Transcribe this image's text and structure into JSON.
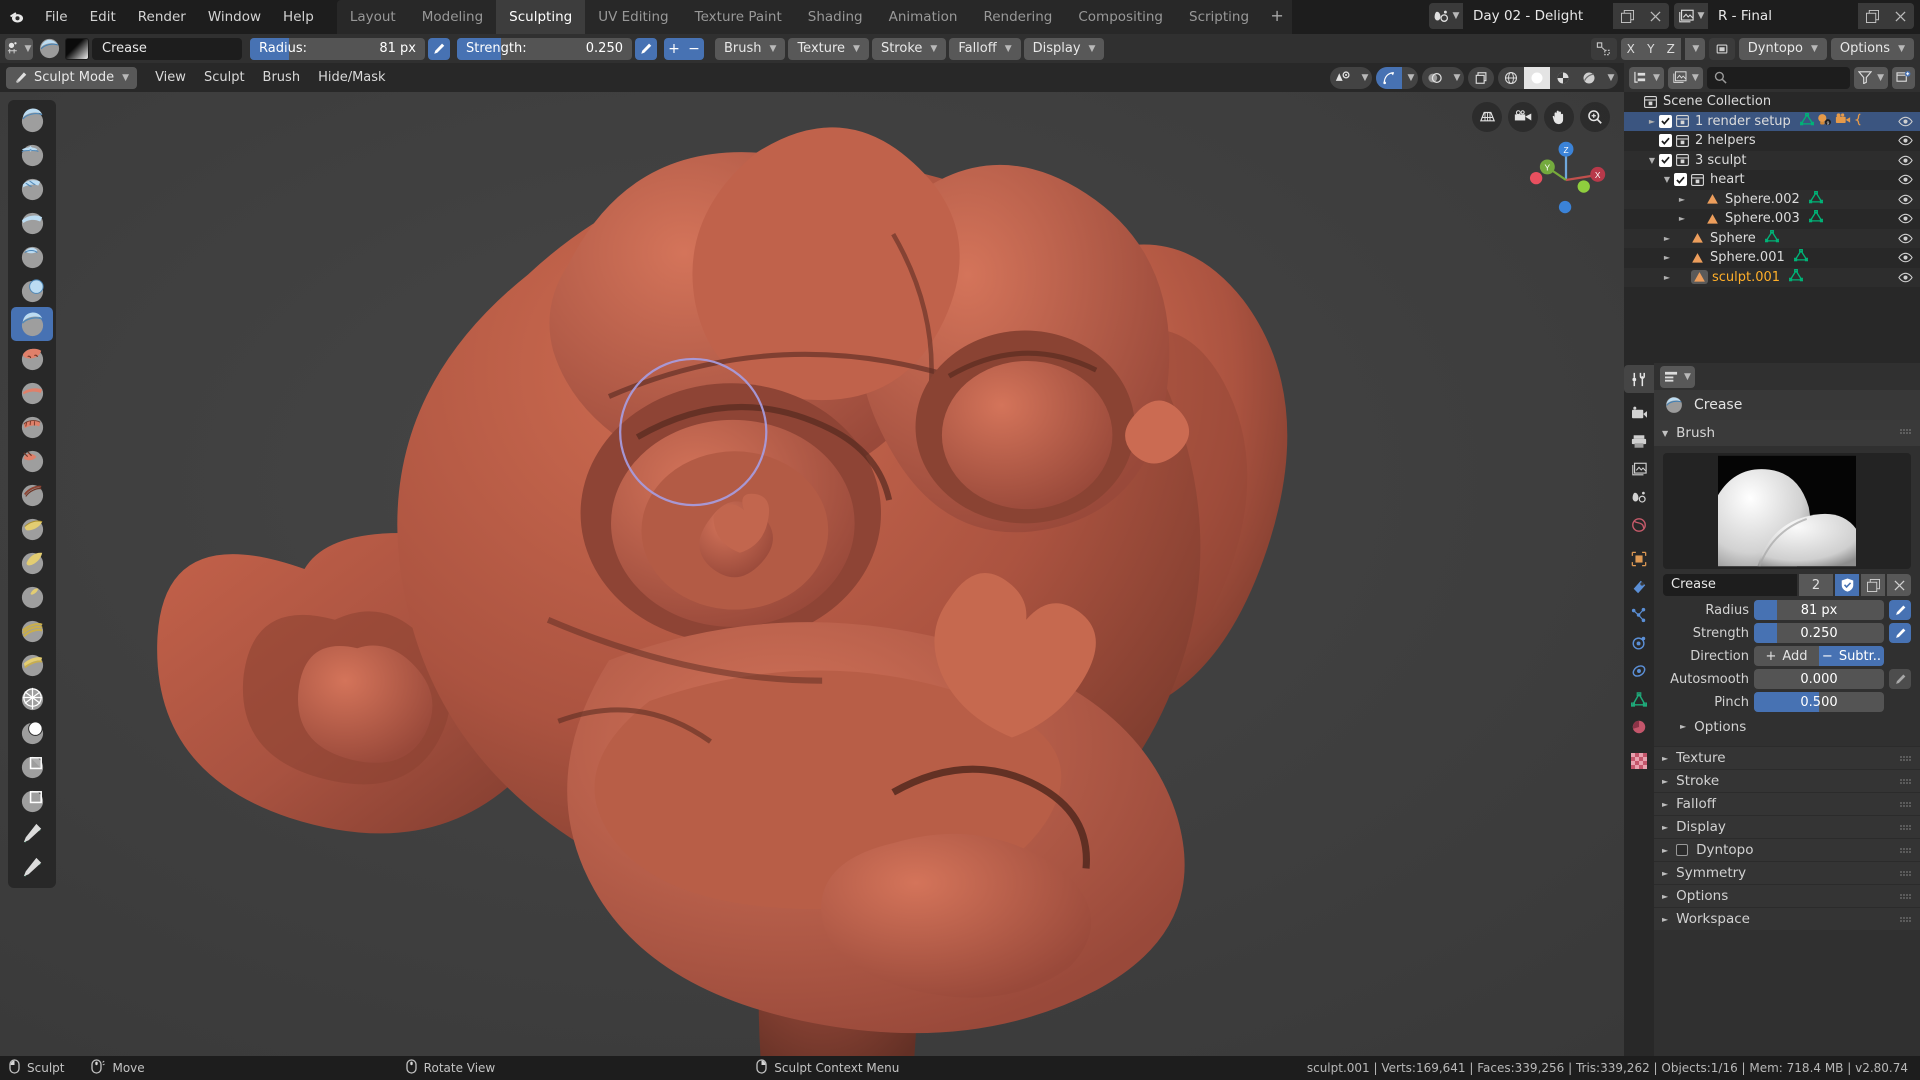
{
  "app": {
    "menus": [
      "File",
      "Edit",
      "Render",
      "Window",
      "Help"
    ],
    "workspace_tabs": [
      {
        "label": "Layout",
        "active": false
      },
      {
        "label": "Modeling",
        "active": false
      },
      {
        "label": "Sculpting",
        "active": true
      },
      {
        "label": "UV Editing",
        "active": false
      },
      {
        "label": "Texture Paint",
        "active": false
      },
      {
        "label": "Shading",
        "active": false
      },
      {
        "label": "Animation",
        "active": false
      },
      {
        "label": "Rendering",
        "active": false
      },
      {
        "label": "Compositing",
        "active": false
      },
      {
        "label": "Scripting",
        "active": false
      }
    ],
    "add_workspace": "+",
    "scene_name": "Day 02 - Delight",
    "view_layer_name": "R - Final"
  },
  "tool_settings": {
    "brush_name": "Crease",
    "radius_label": "Radius:",
    "radius_value": "81 px",
    "radius_fill_pct": 22,
    "strength_label": "Strength:",
    "strength_value": "0.250",
    "strength_fill_pct": 25,
    "add_sign": "+",
    "subtract_sign": "−",
    "popovers": [
      "Brush",
      "Texture",
      "Stroke",
      "Falloff",
      "Display"
    ],
    "symmetry_axes": [
      "X",
      "Y",
      "Z"
    ],
    "dyntopo_label": "Dyntopo",
    "options_label": "Options"
  },
  "viewport_header": {
    "mode": "Sculpt Mode",
    "menus": [
      "View",
      "Sculpt",
      "Brush",
      "Hide/Mask"
    ]
  },
  "toolbar": {
    "tools": [
      {
        "name": "draw-brush-tool",
        "active": false
      },
      {
        "name": "draw-sharp-tool",
        "active": false
      },
      {
        "name": "clay-tool",
        "active": false
      },
      {
        "name": "clay-strips-tool",
        "active": false
      },
      {
        "name": "layer-tool",
        "active": false
      },
      {
        "name": "inflate-tool",
        "active": false
      },
      {
        "name": "crease-tool",
        "active": true
      },
      {
        "name": "blob-tool",
        "active": false
      },
      {
        "name": "flatten-tool",
        "active": false
      },
      {
        "name": "fill-tool",
        "active": false
      },
      {
        "name": "scrape-tool",
        "active": false
      },
      {
        "name": "pinch-tool",
        "active": false
      },
      {
        "name": "grab-tool",
        "active": false
      },
      {
        "name": "elastic-deform-tool",
        "active": false
      },
      {
        "name": "snake-hook-tool",
        "active": false
      },
      {
        "name": "thumb-tool",
        "active": false
      },
      {
        "name": "pose-tool",
        "active": false
      },
      {
        "name": "nudge-tool",
        "active": false
      },
      {
        "name": "simplify-tool",
        "active": false
      },
      {
        "name": "mask-tool",
        "active": false
      },
      {
        "name": "box-mask-tool",
        "active": false
      },
      {
        "name": "box-hide-tool",
        "active": false
      },
      {
        "name": "annotate-tool",
        "active": false
      }
    ]
  },
  "outliner": {
    "search_placeholder": "",
    "rows": [
      {
        "label": "Scene Collection",
        "indent": 0,
        "icon": "collection",
        "tri": "",
        "check": false,
        "selected": false,
        "orange": false,
        "eye": false,
        "extra": []
      },
      {
        "label": "1 render setup",
        "indent": 1,
        "icon": "collection",
        "tri": "right",
        "check": true,
        "selected": true,
        "orange": false,
        "eye": true,
        "extra": [
          "mesh-data",
          "light",
          "camera",
          "curve"
        ]
      },
      {
        "label": "2 helpers",
        "indent": 1,
        "icon": "collection",
        "tri": "",
        "check": true,
        "selected": false,
        "orange": false,
        "eye": true,
        "extra": []
      },
      {
        "label": "3 sculpt",
        "indent": 1,
        "icon": "collection",
        "tri": "down",
        "check": true,
        "selected": false,
        "orange": false,
        "eye": true,
        "extra": []
      },
      {
        "label": "heart",
        "indent": 2,
        "icon": "collection",
        "tri": "down",
        "check": true,
        "selected": false,
        "orange": false,
        "eye": true,
        "extra": []
      },
      {
        "label": "Sphere.002",
        "indent": 3,
        "icon": "mesh-object",
        "tri": "right",
        "check": false,
        "selected": false,
        "orange": false,
        "eye": true,
        "extra": [
          "mesh-data"
        ]
      },
      {
        "label": "Sphere.003",
        "indent": 3,
        "icon": "mesh-object",
        "tri": "right",
        "check": false,
        "selected": false,
        "orange": false,
        "eye": true,
        "extra": [
          "mesh-data"
        ]
      },
      {
        "label": "Sphere",
        "indent": 2,
        "icon": "mesh-object",
        "tri": "right",
        "check": false,
        "selected": false,
        "orange": false,
        "eye": true,
        "extra": [
          "mesh-data"
        ]
      },
      {
        "label": "Sphere.001",
        "indent": 2,
        "icon": "mesh-object",
        "tri": "right",
        "check": false,
        "selected": false,
        "orange": false,
        "eye": true,
        "extra": [
          "mesh-data"
        ]
      },
      {
        "label": "sculpt.001",
        "indent": 2,
        "icon": "mesh-object",
        "tri": "right",
        "check": false,
        "selected": false,
        "orange": true,
        "eye": true,
        "extra": [
          "mesh-data"
        ]
      }
    ]
  },
  "properties": {
    "breadcrumb_brush": "Crease",
    "brush_panel_title": "Brush",
    "brush_name": "Crease",
    "brush_users": "2",
    "fields": [
      {
        "label": "Radius",
        "value": "81 px",
        "fill_pct": 18,
        "pen": "on",
        "type": "slider"
      },
      {
        "label": "Strength",
        "value": "0.250",
        "fill_pct": 18,
        "pen": "on",
        "type": "slider"
      },
      {
        "label": "Autosmooth",
        "value": "0.000",
        "fill_pct": 0,
        "pen": "off",
        "type": "slider"
      },
      {
        "label": "Pinch",
        "value": "0.500",
        "fill_pct": 50,
        "pen": "none",
        "type": "slider"
      }
    ],
    "direction_label": "Direction",
    "direction_add": "Add",
    "direction_subtract": "Subtr..",
    "direction_active": "subtract",
    "sub_panel": "Options",
    "collapsed_panels": [
      {
        "label": "Texture",
        "checkbox": false
      },
      {
        "label": "Stroke",
        "checkbox": false
      },
      {
        "label": "Falloff",
        "checkbox": false
      },
      {
        "label": "Display",
        "checkbox": false
      },
      {
        "label": "Dyntopo",
        "checkbox": true
      },
      {
        "label": "Symmetry",
        "checkbox": false
      },
      {
        "label": "Options",
        "checkbox": false
      },
      {
        "label": "Workspace",
        "checkbox": false
      }
    ]
  },
  "status_bar": {
    "keymap": [
      {
        "mouse": "left",
        "label": "Sculpt"
      },
      {
        "mouse": "middle-drag",
        "label": "Move"
      },
      {
        "mouse": "middle",
        "label": "Rotate View"
      },
      {
        "mouse": "right",
        "label": "Sculpt Context Menu"
      }
    ],
    "stats": "sculpt.001 | Verts:169,641 | Faces:339,256 | Tris:339,262 | Objects:1/16 | Mem: 718.4 MB | v2.80.74"
  },
  "colors": {
    "accent_blue": "#4772b3",
    "selection_orange": "#ffaf29",
    "mesh_green": "#00b377",
    "object_orange": "#ed9e5c",
    "background": "#1d1d1d",
    "panel": "#303030",
    "viewport": "#3b3b3b",
    "model": "#a8513c"
  }
}
